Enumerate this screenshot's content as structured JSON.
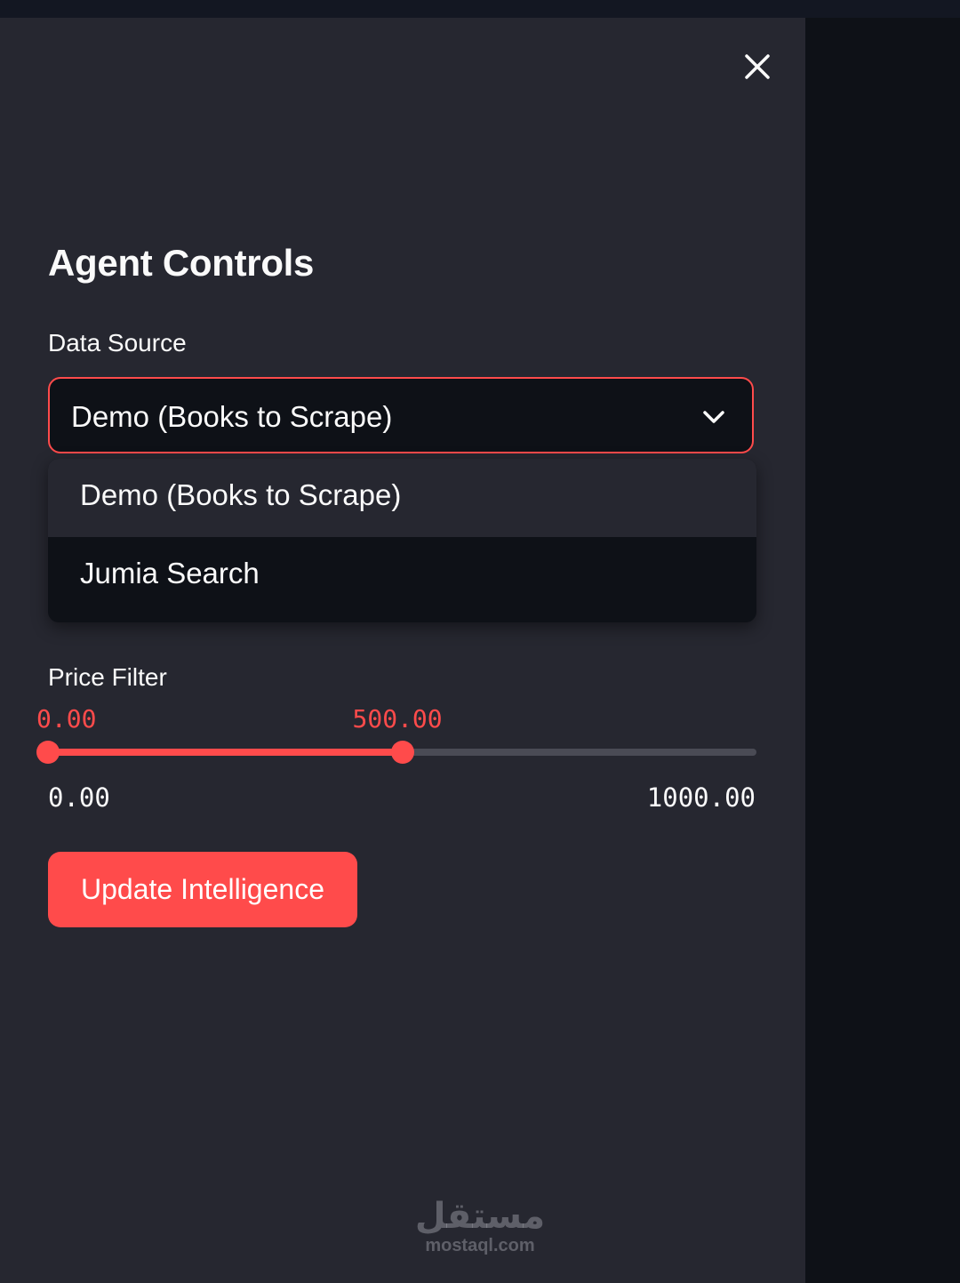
{
  "sidebar": {
    "title": "Agent Controls",
    "close_icon": "close-icon",
    "data_source": {
      "label": "Data Source",
      "selected": "Demo (Books to Scrape)",
      "chevron_icon": "chevron-down-icon",
      "options": [
        {
          "label": "Demo (Books to Scrape)",
          "highlighted": true
        },
        {
          "label": "Jumia Search",
          "highlighted": false
        }
      ]
    },
    "price_filter": {
      "label": "Price Filter",
      "low_value": 0,
      "high_value": 500,
      "low_value_text": "0.00",
      "high_value_text": "500.00",
      "min": 0,
      "max": 1000,
      "min_text": "0.00",
      "max_text": "1000.00"
    },
    "action_button": "Update Intelligence"
  },
  "watermark": {
    "arabic": "مستقل",
    "latin": "mostaql.com"
  },
  "colors": {
    "accent": "#ff4b4b",
    "sidebar_bg": "#262730",
    "main_bg": "#0e1117",
    "text": "#fafafa"
  }
}
